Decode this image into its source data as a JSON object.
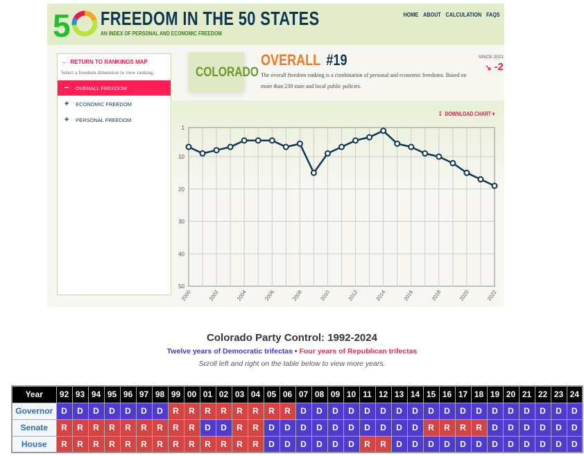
{
  "header": {
    "title": "FREEDOM IN THE 50 STATES",
    "subtitle": "AN INDEX OF PERSONAL AND ECONOMIC FREEDOM",
    "logo_text": "50",
    "nav": [
      "HOME",
      "ABOUT",
      "CALCULATION",
      "FAQS"
    ]
  },
  "sidebar": {
    "return_label": "RETURN TO RANKINGS MAP",
    "hint": "Select a freedom dimension to view ranking.",
    "items": [
      {
        "label": "OVERALL FREEDOM",
        "icon": "minus",
        "active": true
      },
      {
        "label": "ECONOMIC FREEDOM",
        "icon": "plus"
      },
      {
        "label": "PERSONAL FREEDOM",
        "icon": "plus"
      }
    ]
  },
  "state": "COLORADO",
  "ranking": {
    "dimension": "OVERALL",
    "rank": "#19",
    "description": "The overall freedom ranking is a combination of personal and economic freedoms. Based on more than 230 state and local public policies.",
    "since_label": "SINCE 2021",
    "change": "-2",
    "trend_icon": "trend-down-icon"
  },
  "download_label": "DOWNLOAD CHART",
  "chart_data": {
    "type": "line",
    "x": [
      2000,
      2001,
      2002,
      2003,
      2004,
      2005,
      2006,
      2007,
      2008,
      2009,
      2010,
      2011,
      2012,
      2013,
      2014,
      2015,
      2016,
      2017,
      2018,
      2019,
      2020,
      2021,
      2022
    ],
    "y": [
      7,
      9,
      8,
      7,
      5,
      5,
      5,
      7,
      6,
      15,
      9,
      7,
      5,
      4,
      2,
      6,
      7,
      9,
      10,
      12,
      15,
      17,
      19
    ],
    "ylim": [
      1,
      50
    ],
    "y_reversed": true,
    "yticks": [
      1,
      10,
      20,
      30,
      40,
      50
    ],
    "xticks": [
      2000,
      2002,
      2004,
      2006,
      2008,
      2010,
      2012,
      2014,
      2016,
      2018,
      2020,
      2022
    ],
    "grid": true,
    "line_color": "#0d3552"
  },
  "party": {
    "title": "Colorado Party Control: 1992-2024",
    "dem_text": "Twelve years of Democratic trifectas",
    "sep": "•",
    "rep_text": "Four years of Republican trifectas",
    "scroll_hint": "Scroll left and right on the table below to view more years.",
    "dem_color": "#4f3bd1",
    "rep_color": "#d64343",
    "year_label": "Year",
    "years": [
      "92",
      "93",
      "94",
      "95",
      "96",
      "97",
      "98",
      "99",
      "00",
      "01",
      "02",
      "03",
      "04",
      "05",
      "06",
      "07",
      "08",
      "09",
      "10",
      "11",
      "12",
      "13",
      "14",
      "15",
      "16",
      "17",
      "18",
      "19",
      "20",
      "21",
      "22",
      "23",
      "24"
    ],
    "rows": [
      {
        "label": "Governor",
        "values": "DDDDDDDRRRRRRRRDDDDDDDDDDDDDDDDDD"
      },
      {
        "label": "Senate",
        "values": "RRRRRRRRRDDRRDDDDDDDDDDRRRRDDDDDD"
      },
      {
        "label": "House",
        "values": "RRRRRRRRRRRRRDDDDDDRRDDDDDDDDDDDD"
      }
    ]
  }
}
